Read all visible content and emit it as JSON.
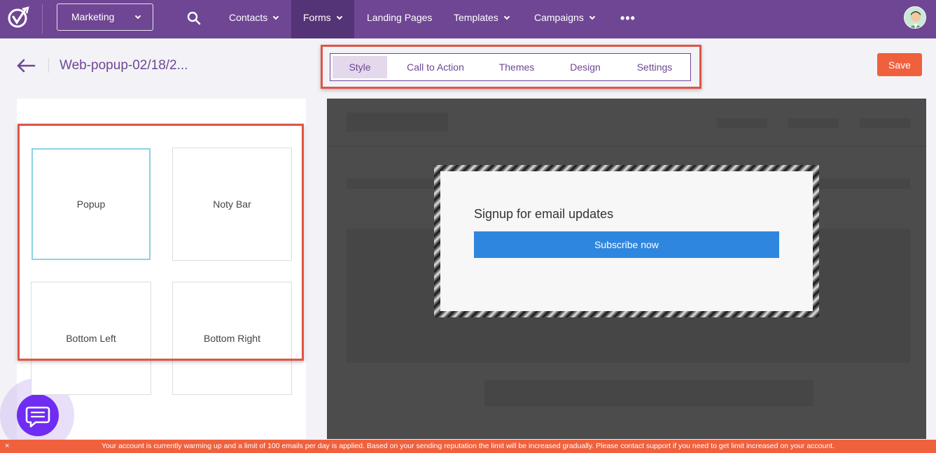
{
  "colors": {
    "brand": "#6e4693",
    "accent": "#f0603d",
    "selected_border": "#8fd0e6",
    "cta_blue": "#2e86de",
    "chat": "#6f2cf3"
  },
  "nav": {
    "workspace": "Marketing",
    "items": [
      {
        "label": "Contacts"
      },
      {
        "label": "Forms"
      },
      {
        "label": "Landing Pages"
      },
      {
        "label": "Templates"
      },
      {
        "label": "Campaigns"
      }
    ],
    "more": "•••",
    "icons": {
      "logo": "logo-icon",
      "search": "search-icon",
      "avatar": "avatar",
      "more": "more-icon"
    }
  },
  "header": {
    "title": "Web-popup-02/18/2...",
    "save_label": "Save"
  },
  "tabs": [
    {
      "label": "Style",
      "active": true
    },
    {
      "label": "Call to Action"
    },
    {
      "label": "Themes"
    },
    {
      "label": "Design"
    },
    {
      "label": "Settings"
    }
  ],
  "styles": [
    {
      "label": "Popup",
      "selected": true
    },
    {
      "label": "Noty Bar"
    },
    {
      "label": "Bottom Left"
    },
    {
      "label": "Bottom Right"
    }
  ],
  "preview": {
    "heading": "Signup for email updates",
    "button_label": "Subscribe now"
  },
  "banner": {
    "close": "×",
    "text": "Your account is currently warming up and a limit of 100 emails per day is applied. Based on your sending reputation the limit will be increased gradually. Please contact support if you need to get limit increased on your account."
  }
}
